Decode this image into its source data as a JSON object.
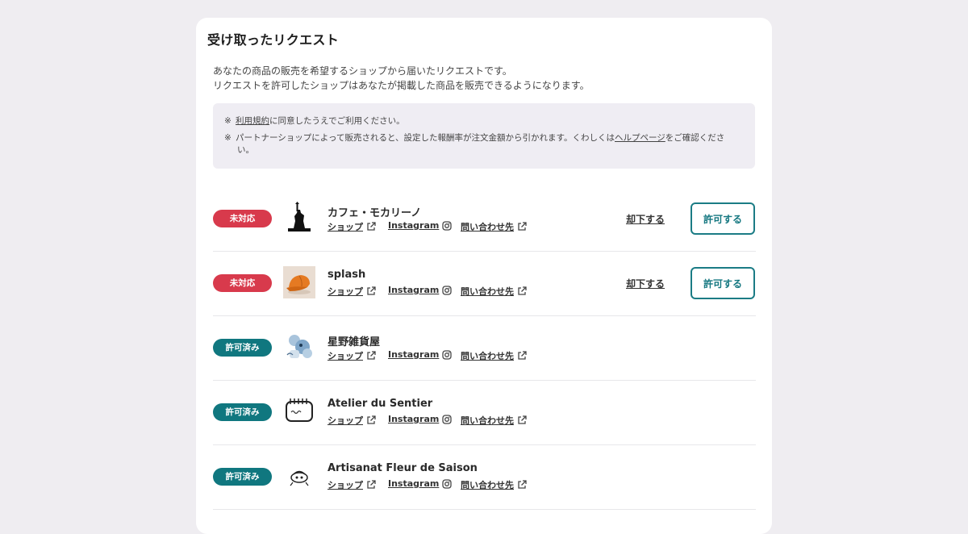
{
  "page": {
    "title": "受け取ったリクエスト",
    "description": [
      "あなたの商品の販売を希望するショップから届いたリクエストです。",
      "リクエストを許可したショップはあなたが掲載した商品を販売できるようになります。"
    ]
  },
  "notice": {
    "mark": "※",
    "line1": {
      "link": "利用規約",
      "text": "に同意したうえでご利用ください。"
    },
    "line2": {
      "text_before": "パートナーショップによって販売されると、設定した報酬率が注文金額から引かれます。くわしくは",
      "link": "ヘルプページ",
      "text_after_line1": "をご確認くださ",
      "text_after_line2": "い。"
    }
  },
  "link_labels": {
    "shop": "ショップ",
    "instagram": "Instagram",
    "contact": "問い合わせ先"
  },
  "actions": {
    "reject": "却下する",
    "approve": "許可する"
  },
  "status_labels": {
    "pending": "未対応",
    "approved": "許可済み"
  },
  "colors": {
    "pending": "#d83a4c",
    "approved": "#10777f",
    "approve_border": "#1b7c85"
  },
  "requests": [
    {
      "name": "カフェ・モカリーノ",
      "status": "未対応",
      "avatar_icon": "statue-of-liberty-icon"
    },
    {
      "name": "splash",
      "status": "未対応",
      "avatar_icon": "orange-cap-icon"
    },
    {
      "name": "星野雑貨屋",
      "status": "許可済み",
      "avatar_icon": "blue-figure-illustration-icon"
    },
    {
      "name": "Atelier du Sentier",
      "status": "許可済み",
      "avatar_icon": "notepad-sketch-icon"
    },
    {
      "name": "Artisanat Fleur de Saison",
      "status": "許可済み",
      "avatar_icon": "ink-sketch-icon"
    }
  ]
}
